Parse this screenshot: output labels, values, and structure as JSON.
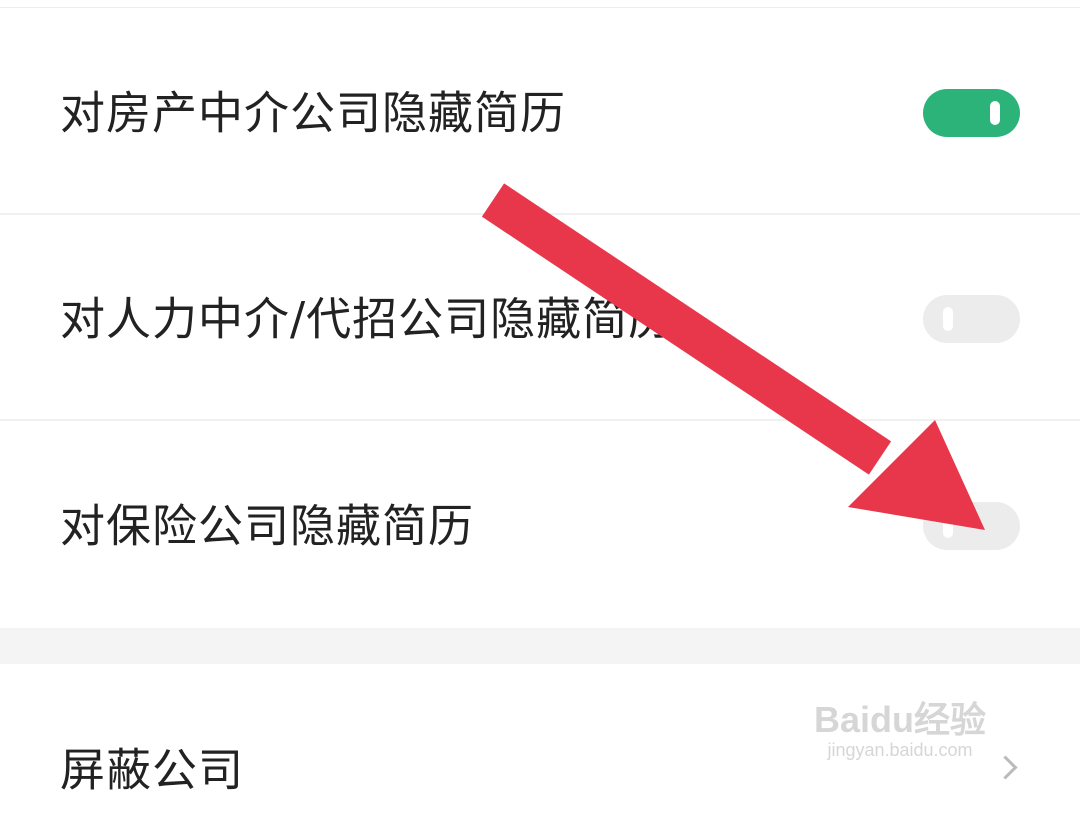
{
  "settings": {
    "items": [
      {
        "label": "对房产中介公司隐藏简历",
        "enabled": true
      },
      {
        "label": "对人力中介/代招公司隐藏简历",
        "enabled": false
      },
      {
        "label": "对保险公司隐藏简历",
        "enabled": false
      }
    ]
  },
  "navigation": {
    "blocked_companies_label": "屏蔽公司",
    "chevron_icon": "chevron-right-icon"
  },
  "overlay": {
    "annotation_icon": "red-arrow-icon",
    "arrow_color": "#e8364a"
  },
  "watermark": {
    "logo_text": "Baidu经验",
    "url_text": "jingyan.baidu.com"
  },
  "colors": {
    "toggle_on": "#2bb37a",
    "toggle_off": "#ececec",
    "text": "#222222"
  }
}
